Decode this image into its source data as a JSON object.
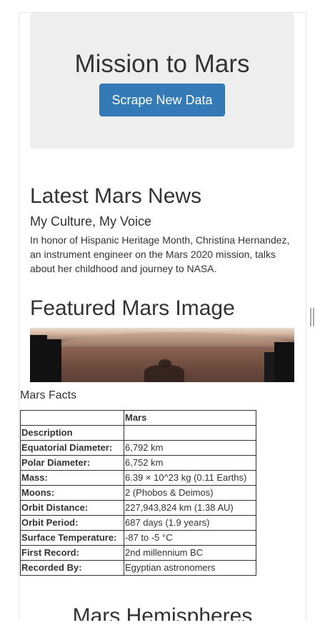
{
  "jumbotron": {
    "title": "Mission to Mars",
    "button_label": "Scrape New Data"
  },
  "news": {
    "heading": "Latest Mars News",
    "title": "My Culture, My Voice",
    "paragraph": "In honor of Hispanic Heritage Month, Christina Hernandez, an instrument engineer on the Mars 2020 mission, talks about her childhood and journey to NASA."
  },
  "featured": {
    "heading": "Featured Mars Image"
  },
  "facts": {
    "caption": "Mars Facts",
    "columns": [
      "",
      "Mars"
    ],
    "rows": [
      {
        "label": "Description",
        "value": ""
      },
      {
        "label": "Equatorial Diameter:",
        "value": "6,792 km"
      },
      {
        "label": "Polar Diameter:",
        "value": "6,752 km"
      },
      {
        "label": "Mass:",
        "value": "6.39 × 10^23 kg (0.11 Earths)"
      },
      {
        "label": "Moons:",
        "value": "2 (Phobos & Deimos)"
      },
      {
        "label": "Orbit Distance:",
        "value": "227,943,824 km (1.38 AU)"
      },
      {
        "label": "Orbit Period:",
        "value": "687 days (1.9 years)"
      },
      {
        "label": "Surface Temperature:",
        "value": "-87 to -5 °C"
      },
      {
        "label": "First Record:",
        "value": "2nd millennium BC"
      },
      {
        "label": "Recorded By:",
        "value": "Egyptian astronomers"
      }
    ]
  },
  "hemispheres": {
    "heading": "Mars Hemispheres"
  },
  "colors": {
    "primary_button": "#337ab7",
    "jumbotron_bg": "#eeeeee"
  }
}
